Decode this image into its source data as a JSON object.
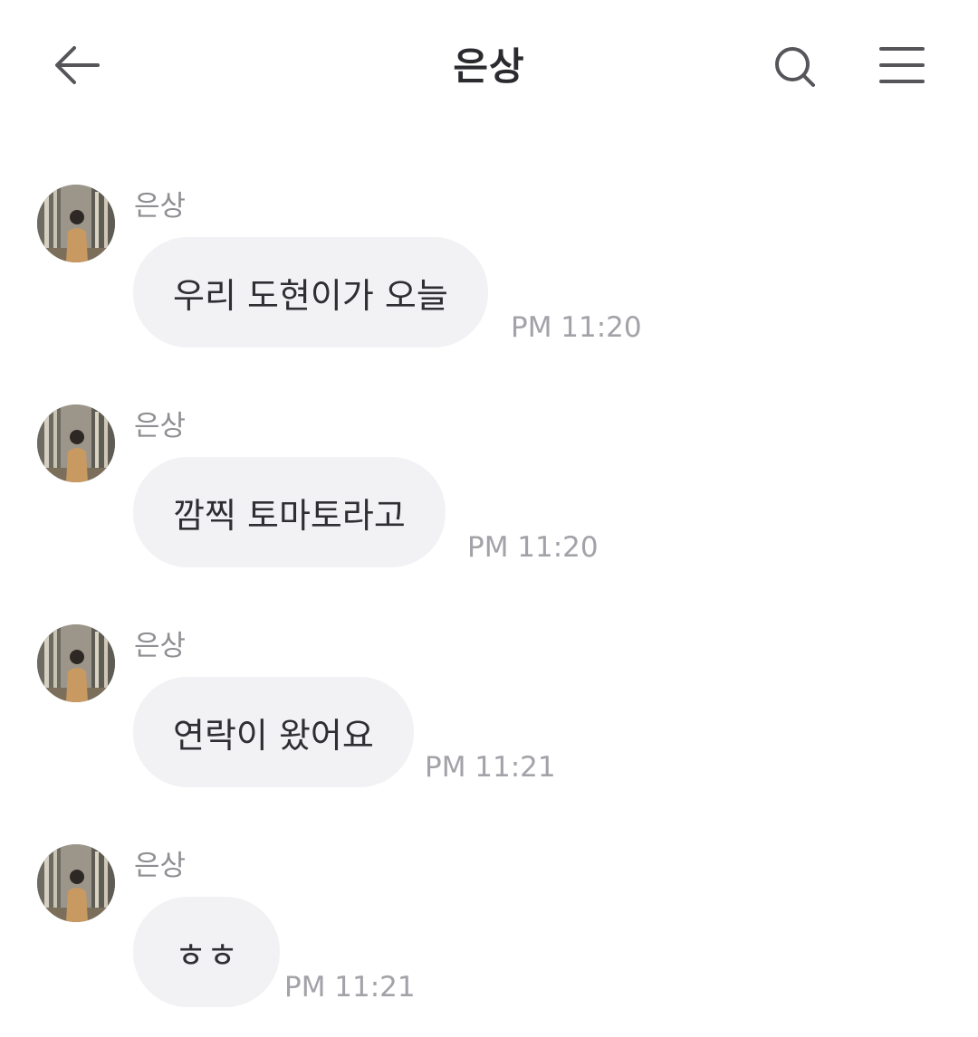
{
  "header": {
    "title": "은상",
    "back_icon": "arrow-left-icon",
    "search_icon": "search-icon",
    "menu_icon": "hamburger-menu-icon"
  },
  "messages": [
    {
      "sender": "은상",
      "text": "우리 도현이가 오늘",
      "time": "PM 11:20"
    },
    {
      "sender": "은상",
      "text": "깜찍 토마토라고",
      "time": "PM 11:20"
    },
    {
      "sender": "은상",
      "text": "연락이 왔어요",
      "time": "PM 11:21"
    },
    {
      "sender": "은상",
      "text": "ㅎㅎ",
      "time": "PM 11:21"
    }
  ],
  "colors": {
    "bubble": "#f2f2f5",
    "text": "#2f2f33",
    "muted": "#a2a2a8",
    "icon": "#55555a"
  }
}
